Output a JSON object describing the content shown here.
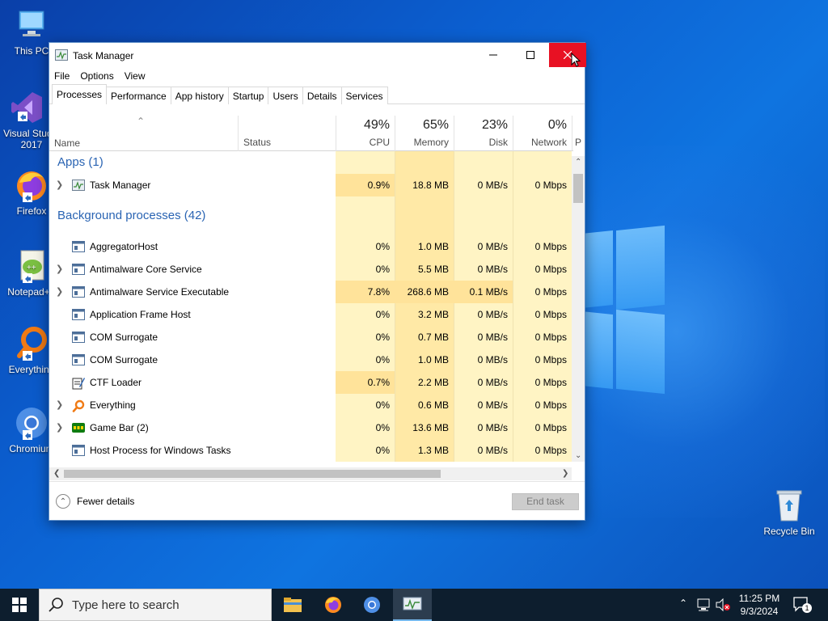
{
  "desktop": {
    "icons": [
      {
        "label": "This PC"
      },
      {
        "label": "Visual Studio 2017"
      },
      {
        "label": "Firefox"
      },
      {
        "label": "Notepad++"
      },
      {
        "label": "Everything"
      },
      {
        "label": "Chromium"
      }
    ],
    "recycle_bin": {
      "label": "Recycle Bin"
    }
  },
  "window": {
    "title": "Task Manager",
    "menu": [
      "File",
      "Options",
      "View"
    ],
    "tabs": [
      "Processes",
      "Performance",
      "App history",
      "Startup",
      "Users",
      "Details",
      "Services"
    ],
    "active_tab": "Processes",
    "columns": {
      "name": "Name",
      "status": "Status",
      "cpu": {
        "label": "CPU",
        "pct": "49%"
      },
      "memory": {
        "label": "Memory",
        "pct": "65%"
      },
      "disk": {
        "label": "Disk",
        "pct": "23%"
      },
      "network": {
        "label": "Network",
        "pct": "0%"
      },
      "power": {
        "label": "P"
      }
    },
    "groups": {
      "apps": "Apps (1)",
      "background": "Background processes (42)"
    },
    "apps": [
      {
        "name": "Task Manager",
        "cpu": "0.9%",
        "memory": "18.8 MB",
        "disk": "0 MB/s",
        "network": "0 Mbps",
        "expandable": true,
        "icon": "task-manager-icon"
      }
    ],
    "background": [
      {
        "name": "AggregatorHost",
        "cpu": "0%",
        "memory": "1.0 MB",
        "disk": "0 MB/s",
        "network": "0 Mbps",
        "expandable": false,
        "icon": "process-icon"
      },
      {
        "name": "Antimalware Core Service",
        "cpu": "0%",
        "memory": "5.5 MB",
        "disk": "0 MB/s",
        "network": "0 Mbps",
        "expandable": true,
        "icon": "process-icon"
      },
      {
        "name": "Antimalware Service Executable",
        "cpu": "7.8%",
        "memory": "268.6 MB",
        "disk": "0.1 MB/s",
        "network": "0 Mbps",
        "expandable": true,
        "icon": "process-icon"
      },
      {
        "name": "Application Frame Host",
        "cpu": "0%",
        "memory": "3.2 MB",
        "disk": "0 MB/s",
        "network": "0 Mbps",
        "expandable": false,
        "icon": "process-icon"
      },
      {
        "name": "COM Surrogate",
        "cpu": "0%",
        "memory": "0.7 MB",
        "disk": "0 MB/s",
        "network": "0 Mbps",
        "expandable": false,
        "icon": "process-icon"
      },
      {
        "name": "COM Surrogate",
        "cpu": "0%",
        "memory": "1.0 MB",
        "disk": "0 MB/s",
        "network": "0 Mbps",
        "expandable": false,
        "icon": "process-icon"
      },
      {
        "name": "CTF Loader",
        "cpu": "0.7%",
        "memory": "2.2 MB",
        "disk": "0 MB/s",
        "network": "0 Mbps",
        "expandable": false,
        "icon": "ctf-loader-icon"
      },
      {
        "name": "Everything",
        "cpu": "0%",
        "memory": "0.6 MB",
        "disk": "0 MB/s",
        "network": "0 Mbps",
        "expandable": true,
        "icon": "everything-icon"
      },
      {
        "name": "Game Bar (2)",
        "cpu": "0%",
        "memory": "13.6 MB",
        "disk": "0 MB/s",
        "network": "0 Mbps",
        "expandable": true,
        "icon": "game-bar-icon"
      },
      {
        "name": "Host Process for Windows Tasks",
        "cpu": "0%",
        "memory": "1.3 MB",
        "disk": "0 MB/s",
        "network": "0 Mbps",
        "expandable": false,
        "icon": "process-icon"
      }
    ],
    "footer": {
      "fewer_details": "Fewer details",
      "end_task": "End task"
    }
  },
  "taskbar": {
    "search_placeholder": "Type here to search",
    "clock_time": "11:25 PM",
    "clock_date": "9/3/2024",
    "notification_count": "1"
  },
  "colors": {
    "desktop_blue": "#0b5fd0",
    "group_blue": "#2a64b3",
    "close_red": "#e81123",
    "heat_light": "#fff4c4",
    "heat_mid": "#ffe8a0",
    "taskbar": "#0d1e2e"
  }
}
